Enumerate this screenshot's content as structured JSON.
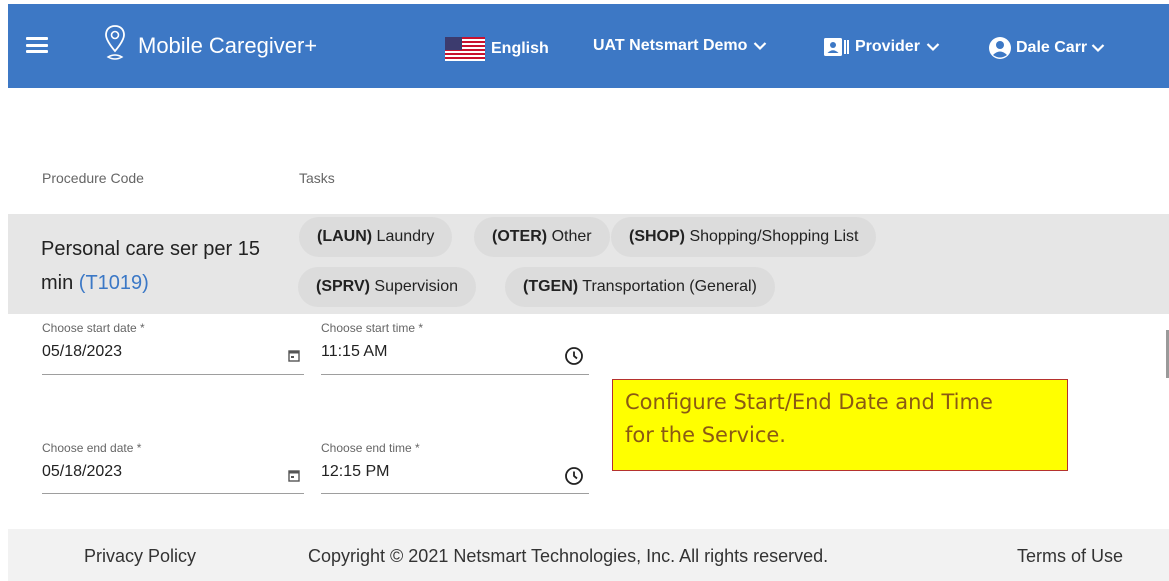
{
  "header": {
    "title": "Mobile Caregiver+",
    "language": "English",
    "organization": "UAT Netsmart Demo",
    "role": "Provider",
    "user": "Dale Carr",
    "bar_color": "#3d78c5",
    "icons": {
      "menu": "hamburger-icon",
      "logo": "location-pin-icon",
      "flag": "us-flag-icon",
      "role": "contact-card-icon",
      "user": "account-circle-icon"
    }
  },
  "table": {
    "col_procedure": "Procedure Code",
    "col_tasks": "Tasks",
    "procedure_name": "Personal care ser per 15 min",
    "procedure_code": "(T1019)",
    "tasks": [
      {
        "code": "(LAUN)",
        "name": "Laundry"
      },
      {
        "code": "(OTER)",
        "name": "Other"
      },
      {
        "code": "(SHOP)",
        "name": "Shopping/Shopping List"
      },
      {
        "code": "(SPRV)",
        "name": "Supervision"
      },
      {
        "code": "(TGEN)",
        "name": "Transportation (General)"
      }
    ]
  },
  "form": {
    "start_date_label": "Choose start date *",
    "start_date": "05/18/2023",
    "start_time_label": "Choose start time *",
    "start_time": "11:15 AM",
    "end_date_label": "Choose end date *",
    "end_date": "05/18/2023",
    "end_time_label": "Choose end time *",
    "end_time": "12:15 PM"
  },
  "callout": {
    "line1": "Configure Start/End Date and Time",
    "line2": "for the Service.",
    "bg_color": "#ffff00"
  },
  "footer": {
    "privacy": "Privacy Policy",
    "copyright": "Copyright © 2021 Netsmart Technologies, Inc. All rights reserved.",
    "terms": "Terms of Use"
  }
}
